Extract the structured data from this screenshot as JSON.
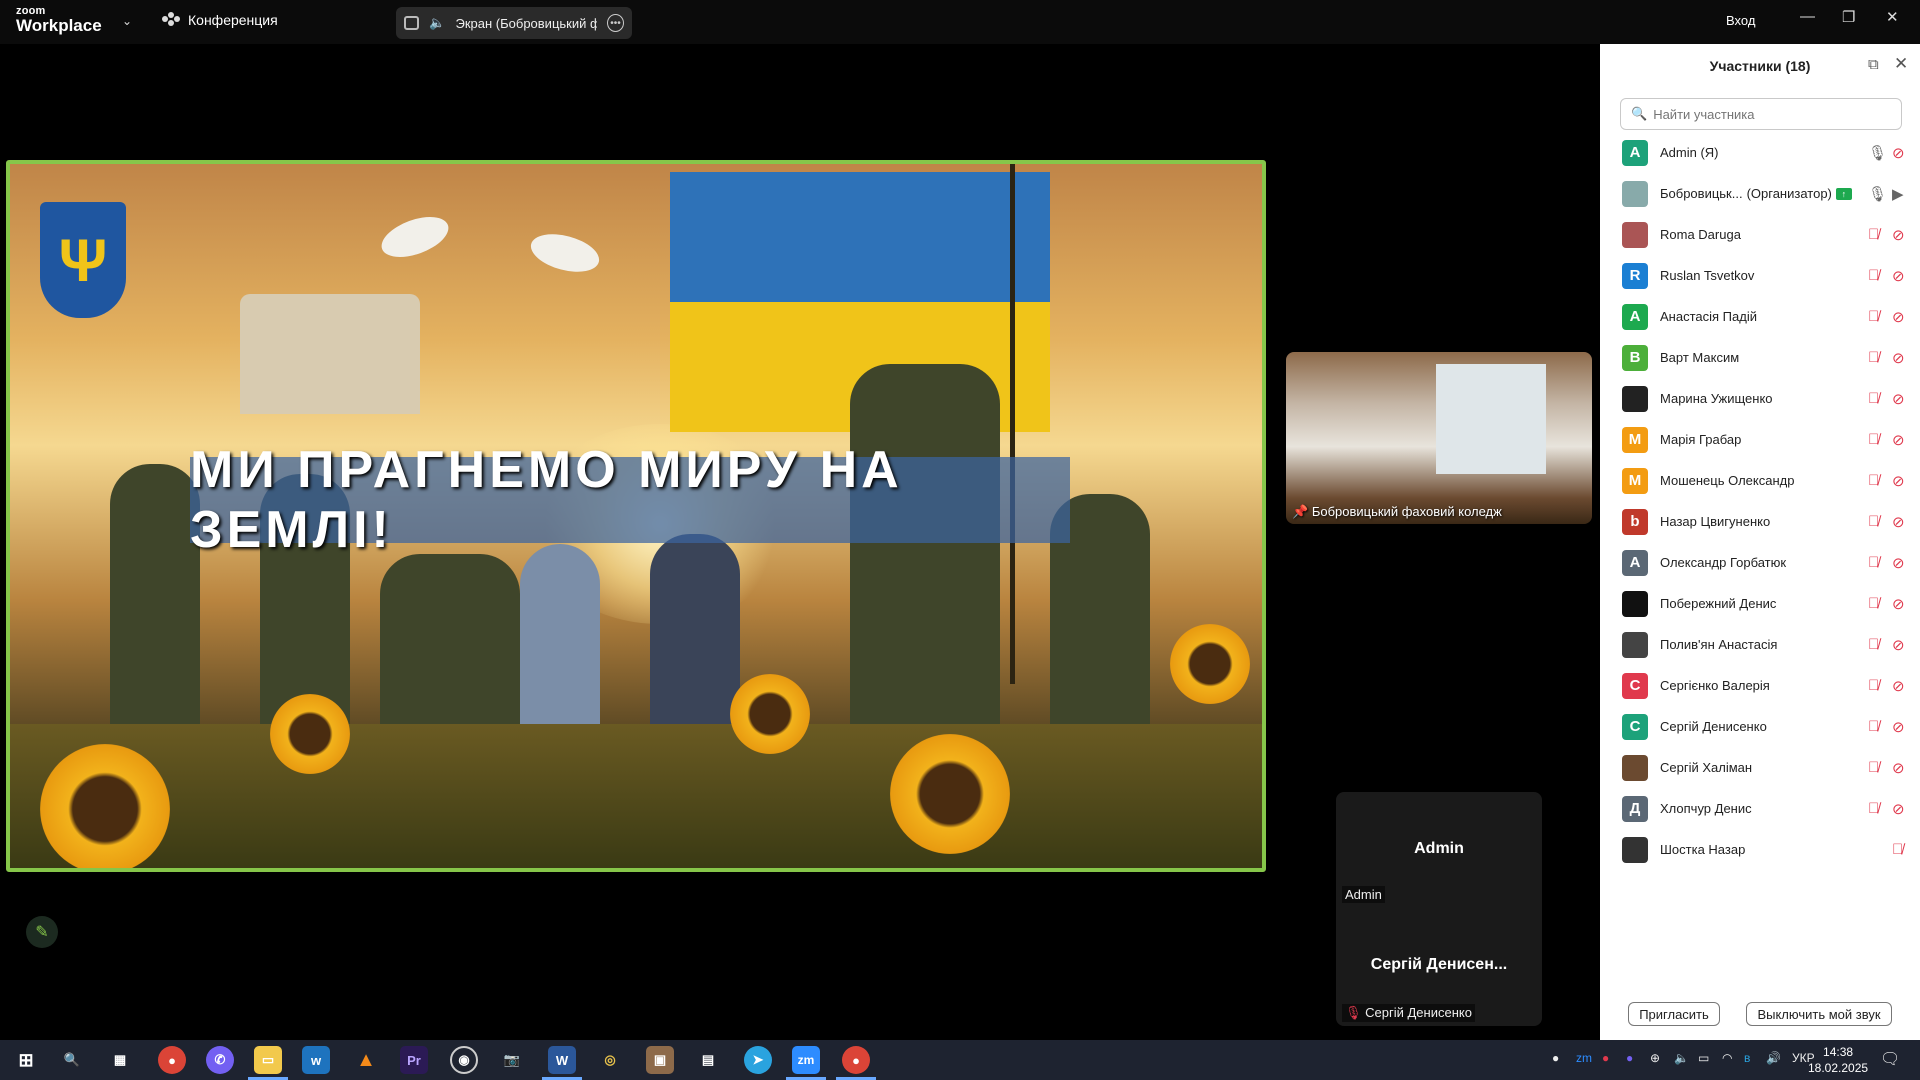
{
  "app": {
    "brand_small": "zoom",
    "brand_big": "Workplace",
    "meeting_label": "Конференция",
    "login": "Вход"
  },
  "screen_share": {
    "label": "Экран (Бобровицький фахо"
  },
  "share_content": {
    "banner_text": "МИ ПРАГНЕМО МИРУ НА ЗЕМЛІ!"
  },
  "video_tiles": {
    "pinned_name": "Бобровицький фаховий коледж",
    "admin_big": "Admin",
    "admin_small": "Admin",
    "serhii_big": "Сергій Денисен...",
    "serhii_small": "Сергій Денисенко"
  },
  "participants": {
    "title": "Участники (18)",
    "search_placeholder": "Найти участника",
    "list": [
      {
        "name": "Admin (Я)",
        "initial": "A",
        "color": "#1da27a",
        "mic": "on",
        "cam": "off"
      },
      {
        "name": "Бобровицьк...",
        "tag": "(Организатор)",
        "initial": "",
        "color": "#8aa",
        "mic": "on",
        "cam": "on",
        "sharing": true
      },
      {
        "name": "Roma Daruga",
        "initial": "",
        "color": "#a55",
        "mic": "off",
        "cam": "off"
      },
      {
        "name": "Ruslan Tsvetkov",
        "initial": "R",
        "color": "#1b7fd3",
        "mic": "off",
        "cam": "off"
      },
      {
        "name": "Анастасія Падій",
        "initial": "A",
        "color": "#1da94f",
        "mic": "off",
        "cam": "off"
      },
      {
        "name": "Варт Максим",
        "initial": "B",
        "color": "#4caf3a",
        "mic": "off",
        "cam": "off"
      },
      {
        "name": "Марина Ужищенко",
        "initial": "",
        "color": "#222",
        "mic": "off",
        "cam": "off"
      },
      {
        "name": "Марія Грабар",
        "initial": "M",
        "color": "#f39c12",
        "mic": "off",
        "cam": "off"
      },
      {
        "name": "Мошенець Олександр",
        "initial": "M",
        "color": "#f39c12",
        "mic": "off",
        "cam": "off"
      },
      {
        "name": "Назар Цвигуненко",
        "initial": "b",
        "color": "#c0392b",
        "mic": "off",
        "cam": "off"
      },
      {
        "name": "Олександр Горбатюк",
        "initial": "A",
        "color": "#5b6875",
        "mic": "off",
        "cam": "off"
      },
      {
        "name": "Побережний Денис",
        "initial": "",
        "color": "#111",
        "mic": "off",
        "cam": "off"
      },
      {
        "name": "Полив'ян Анастасія",
        "initial": "",
        "color": "#444",
        "mic": "off",
        "cam": "off"
      },
      {
        "name": "Сергієнко Валерія",
        "initial": "C",
        "color": "#e0394d",
        "mic": "off",
        "cam": "off"
      },
      {
        "name": "Сергій Денисенко",
        "initial": "C",
        "color": "#1da27a",
        "mic": "off",
        "cam": "off"
      },
      {
        "name": "Сергій Халіман",
        "initial": "",
        "color": "#6b4a30",
        "mic": "off",
        "cam": "off"
      },
      {
        "name": "Хлопчур Денис",
        "initial": "Д",
        "color": "#5b6875",
        "mic": "off",
        "cam": "off"
      },
      {
        "name": "Шостка Назар",
        "initial": "",
        "color": "#333",
        "mic": "off",
        "cam": "none"
      }
    ],
    "invite_label": "Пригласить",
    "mute_label": "Выключить мой звук"
  },
  "taskbar": {
    "lang": "УКР",
    "time": "14:38",
    "date": "18.02.2025"
  },
  "colors": {
    "share_border": "#86c64a",
    "mic_off": "#e0394d"
  }
}
